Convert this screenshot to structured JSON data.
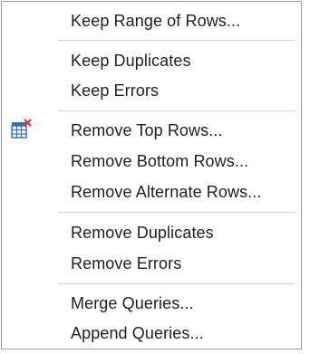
{
  "menu": {
    "groups": [
      {
        "items": [
          {
            "label": "Keep Range of Rows..."
          }
        ]
      },
      {
        "items": [
          {
            "label": "Keep Duplicates"
          },
          {
            "label": "Keep Errors"
          }
        ]
      },
      {
        "items": [
          {
            "label": "Remove Top Rows...",
            "icon": "remove-rows-icon"
          },
          {
            "label": "Remove Bottom Rows..."
          },
          {
            "label": "Remove Alternate Rows..."
          }
        ]
      },
      {
        "items": [
          {
            "label": "Remove Duplicates"
          },
          {
            "label": "Remove Errors"
          }
        ]
      },
      {
        "items": [
          {
            "label": "Merge Queries..."
          },
          {
            "label": "Append Queries..."
          }
        ]
      }
    ],
    "colors": {
      "text": "#1f1f1f",
      "separator": "#d4d4d4",
      "icon_blue": "#2f6fbd",
      "icon_red": "#d9342b"
    }
  }
}
